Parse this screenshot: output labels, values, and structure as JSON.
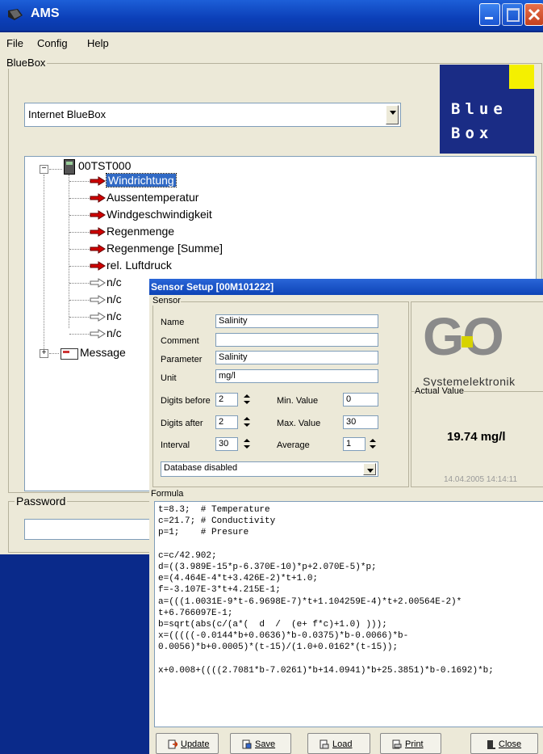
{
  "window": {
    "title": "AMS"
  },
  "menu": [
    "File",
    "Config",
    "Help"
  ],
  "bluebox_group": {
    "legend": "BlueBox",
    "dropdown_value": "Internet BlueBox",
    "logo_line1": "Blue",
    "logo_line2": "Box"
  },
  "tree": {
    "root": "00TST000",
    "items": [
      "Windrichtung",
      "Aussentemperatur",
      "Windgeschwindigkeit",
      "Regenmenge",
      "Regenmenge [Summe]",
      "rel. Luftdruck",
      "n/c",
      "n/c",
      "n/c",
      "n/c"
    ],
    "selected_index": 0,
    "message": "Message"
  },
  "password_group": {
    "legend": "Password",
    "value": ""
  },
  "sensor_dialog": {
    "title": "Sensor Setup [00M101222]",
    "sensor_legend": "Sensor",
    "name_label": "Name",
    "name_value": "Salinity",
    "comment_label": "Comment",
    "comment_value": "",
    "parameter_label": "Parameter",
    "parameter_value": "Salinity",
    "unit_label": "Unit",
    "unit_value": "mg/l",
    "digits_before_label": "Digits before",
    "digits_before_value": "2",
    "digits_after_label": "Digits after",
    "digits_after_value": "2",
    "interval_label": "Interval",
    "interval_value": "30",
    "min_label": "Min. Value",
    "min_value": "0",
    "max_label": "Max. Value",
    "max_value": "30",
    "average_label": "Average",
    "average_value": "1",
    "db_dropdown": "Database disabled",
    "go_logo": "GO",
    "go_sub": "Systemelektronik",
    "actual_legend": "Actual Value",
    "actual_value": "19.74 mg/l",
    "timestamp": "14.04.2005 14:14:11",
    "formula_legend": "Formula",
    "formula_lines": [
      "t=8.3;  # Temperature",
      "c=21.7; # Conductivity",
      "p=1;    # Presure",
      "",
      "c=c/42.902;",
      "d=((3.989E-15*p-6.370E-10)*p+2.070E-5)*p;",
      "e=(4.464E-4*t+3.426E-2)*t+1.0;",
      "f=-3.107E-3*t+4.215E-1;",
      "a=(((1.0031E-9*t-6.9698E-7)*t+1.104259E-4)*t+2.00564E-2)*",
      "t+6.766097E-1;",
      "b=sqrt(abs(c/(a*(  d  /  (e+ f*c)+1.0) )));",
      "x=(((((-0.0144*b+0.0636)*b-0.0375)*b-0.0066)*b-",
      "0.0056)*b+0.0005)*(t-15)/(1.0+0.0162*(t-15));",
      "",
      "x+0.008+((((2.7081*b-7.0261)*b+14.0941)*b+25.3851)*b-0.1692)*b;"
    ],
    "buttons": {
      "update": "Update",
      "save": "Save",
      "load": "Load",
      "print": "Print",
      "close": "Close"
    }
  }
}
